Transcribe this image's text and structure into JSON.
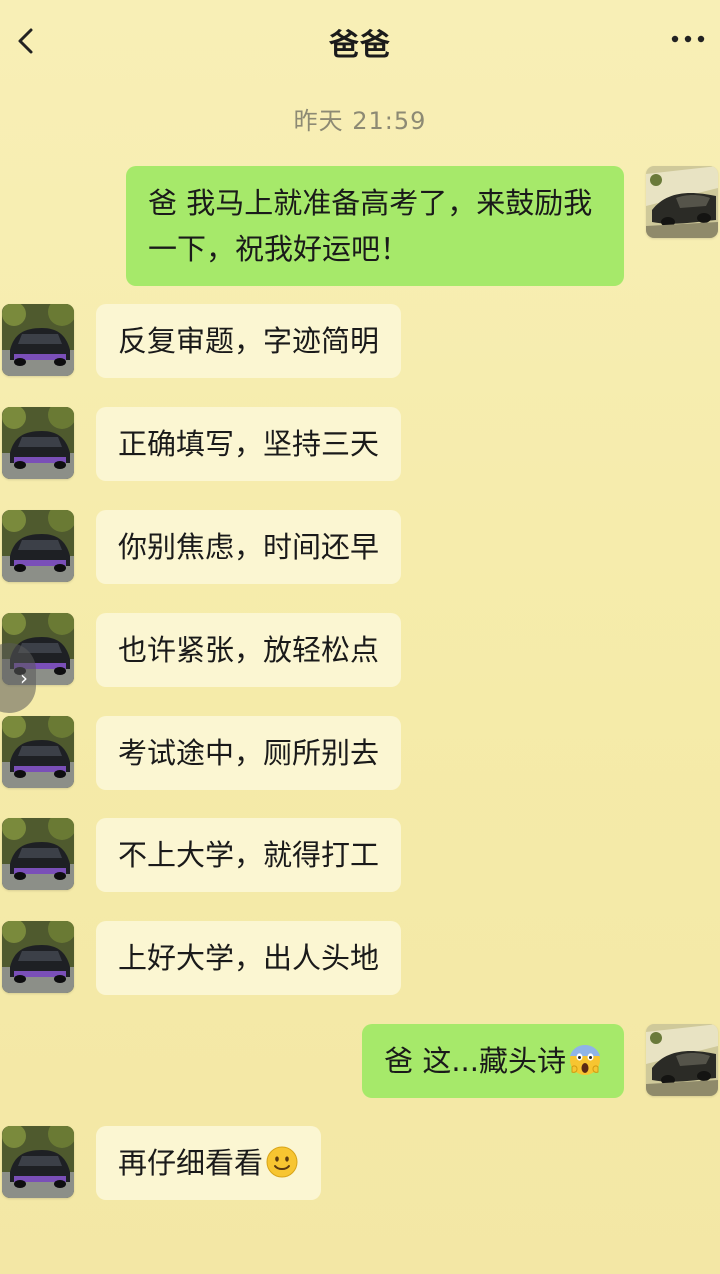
{
  "header": {
    "title": "爸爸",
    "back_icon": "chevron-left-icon",
    "more_icon": "more-horizontal-icon"
  },
  "timestamp": "昨天 21:59",
  "colors": {
    "background": "#f7eeb0",
    "outgoing_bubble": "#a6e96a",
    "incoming_bubble": "#fbf6d2"
  },
  "messages": [
    {
      "sender": "me",
      "text": "爸 我马上就准备高考了，来鼓励我一下，祝我好运吧！"
    },
    {
      "sender": "dad",
      "text": "反复审题，字迹简明"
    },
    {
      "sender": "dad",
      "text": "正确填写，坚持三天"
    },
    {
      "sender": "dad",
      "text": "你别焦虑，时间还早"
    },
    {
      "sender": "dad",
      "text": "也许紧张，放轻松点"
    },
    {
      "sender": "dad",
      "text": "考试途中，厕所别去"
    },
    {
      "sender": "dad",
      "text": "不上大学，就得打工"
    },
    {
      "sender": "dad",
      "text": "上好大学，出人头地"
    },
    {
      "sender": "me",
      "text": "爸 这...藏头诗",
      "emoji": "screaming-face-icon"
    },
    {
      "sender": "dad",
      "text": "再仔细看看",
      "emoji": "smiling-face-icon"
    }
  ],
  "side_arrow": "›"
}
